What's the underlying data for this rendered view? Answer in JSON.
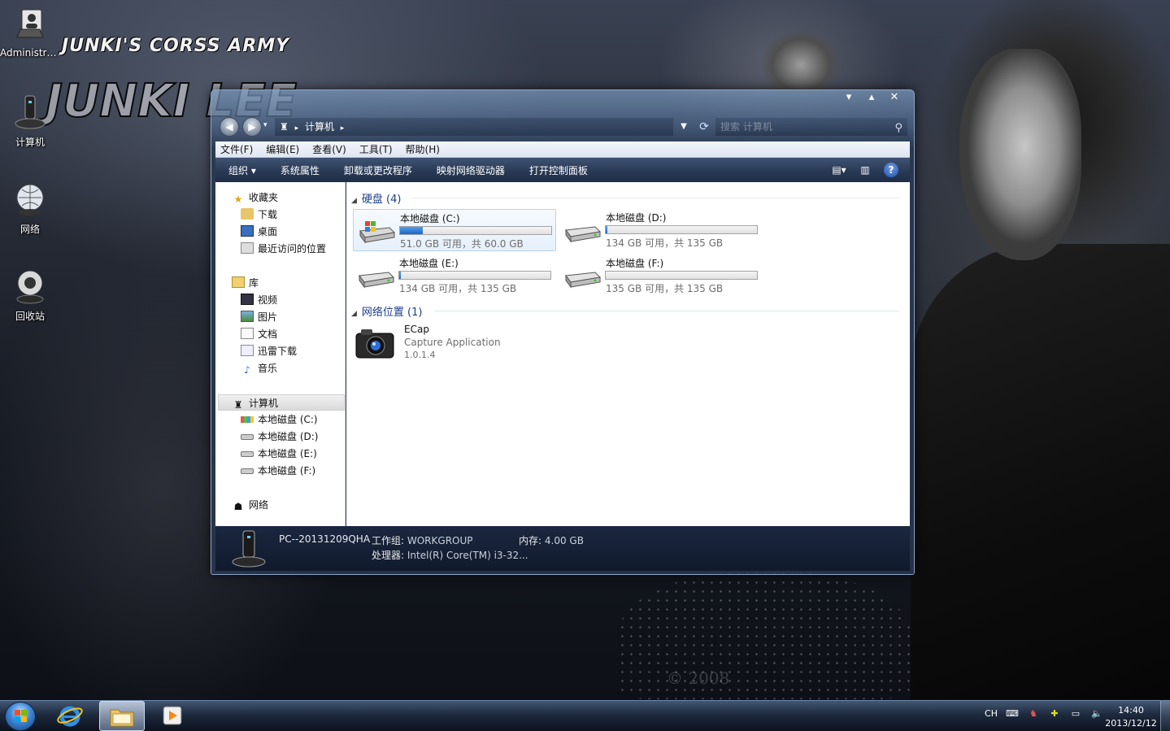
{
  "desktop": {
    "wallpaper_title": "JUNKI'S CORSS ARMY",
    "wallpaper_logo": "JUNKI LEE",
    "icons": [
      {
        "label": "Administra..."
      },
      {
        "label": "计算机"
      },
      {
        "label": "网络"
      },
      {
        "label": "回收站"
      }
    ]
  },
  "window": {
    "caption_buttons": [
      "minimize",
      "maximize",
      "close"
    ],
    "address": {
      "root_icon": "computer-icon",
      "crumb": "计算机",
      "search_placeholder": "搜索 计算机"
    },
    "menu": [
      "文件(F)",
      "编辑(E)",
      "查看(V)",
      "工具(T)",
      "帮助(H)"
    ],
    "toolbar": {
      "organize": "组织 ▾",
      "system_properties": "系统属性",
      "uninstall": "卸载或更改程序",
      "map_drive": "映射网络驱动器",
      "control_panel": "打开控制面板"
    },
    "nav": {
      "favorites": {
        "label": "收藏夹",
        "items": [
          "下载",
          "桌面",
          "最近访问的位置"
        ]
      },
      "libraries": {
        "label": "库",
        "items": [
          "视频",
          "图片",
          "文档",
          "迅雷下载",
          "音乐"
        ]
      },
      "computer": {
        "label": "计算机",
        "items": [
          "本地磁盘 (C:)",
          "本地磁盘 (D:)",
          "本地磁盘 (E:)",
          "本地磁盘 (F:)"
        ]
      },
      "network": {
        "label": "网络"
      }
    },
    "content": {
      "hard_disks_header": "硬盘 (4)",
      "drives": [
        {
          "name": "本地磁盘 (C:)",
          "free": "51.0 GB 可用，共 60.0 GB",
          "used_fraction": 0.15
        },
        {
          "name": "本地磁盘 (D:)",
          "free": "134 GB 可用，共 135 GB",
          "used_fraction": 0.01
        },
        {
          "name": "本地磁盘 (E:)",
          "free": "134 GB 可用，共 135 GB",
          "used_fraction": 0.01
        },
        {
          "name": "本地磁盘 (F:)",
          "free": "135 GB 可用，共 135 GB",
          "used_fraction": 0.0
        }
      ],
      "network_header": "网络位置 (1)",
      "network_app": {
        "name": "ECap",
        "desc": "Capture Application",
        "version": "1.0.1.4"
      }
    },
    "details": {
      "pc_name": "PC--20131209QHA",
      "workgroup_label": "工作组:",
      "workgroup_value": "WORKGROUP",
      "memory_label": "内存:",
      "memory_value": "4.00 GB",
      "cpu_label": "处理器:",
      "cpu_value": "Intel(R) Core(TM) i3-32..."
    }
  },
  "taskbar": {
    "tray": {
      "lang": "CH"
    },
    "clock": {
      "time": "14:40",
      "date": "2013/12/12"
    }
  },
  "colors": {
    "accent": "#1e64c8",
    "group_header": "#1e3f8a",
    "toolbar": "#2b3c58"
  }
}
